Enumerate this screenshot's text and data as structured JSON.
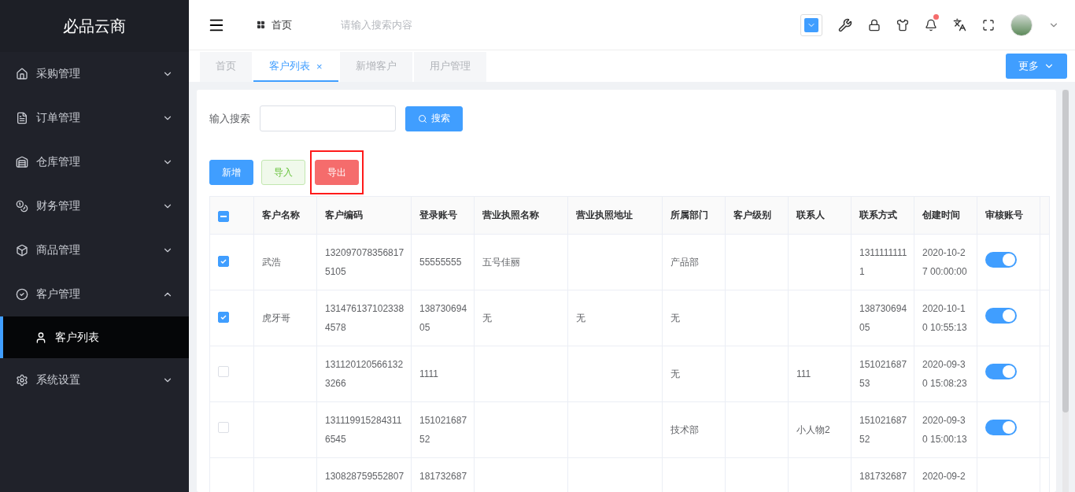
{
  "sidebar": {
    "logo": "必品云商",
    "items": [
      {
        "label": "采购管理",
        "expanded": false
      },
      {
        "label": "订单管理",
        "expanded": false
      },
      {
        "label": "仓库管理",
        "expanded": false
      },
      {
        "label": "财务管理",
        "expanded": false
      },
      {
        "label": "商品管理",
        "expanded": false
      },
      {
        "label": "客户管理",
        "expanded": true,
        "children": [
          {
            "label": "客户列表",
            "selected": true
          }
        ]
      },
      {
        "label": "系统设置",
        "expanded": false
      }
    ]
  },
  "header": {
    "breadcrumb": "首页",
    "search": {
      "placeholder": "请输入搜索内容"
    },
    "notification": true
  },
  "tabs": [
    {
      "label": "首页",
      "selected": false
    },
    {
      "label": "客户列表",
      "selected": true,
      "close": "×"
    },
    {
      "label": "新增客户",
      "selected": false
    },
    {
      "label": "用户管理",
      "selected": false
    }
  ],
  "more_button": "更多",
  "filter": {
    "label": "输入搜索",
    "search_button": "搜索"
  },
  "actions": [
    {
      "label": "新增",
      "kind": "primary",
      "highlighted": false
    },
    {
      "label": "导入",
      "kind": "success",
      "highlighted": false
    },
    {
      "label": "导出",
      "kind": "danger",
      "highlighted": true
    }
  ],
  "table": {
    "partially_selected": true,
    "columns": [
      "客户名称",
      "客户编码",
      "登录账号",
      "营业执照名称",
      "营业执照地址",
      "所属部门",
      "客户级别",
      "联系人",
      "联系方式",
      "创建时间",
      "审核账号"
    ],
    "rows": [
      {
        "selected": true,
        "cells": [
          "武浩",
          "1320970783568175105",
          "55555555",
          "五号佳丽",
          "",
          "产品部",
          "",
          "",
          "13111111111",
          "2020-10-27 00:00:00"
        ],
        "approved": true
      },
      {
        "selected": true,
        "cells": [
          "虎牙哥",
          "1314761371023384578",
          "13873069405",
          "无",
          "无",
          "无",
          "",
          "",
          "13873069405",
          "2020-10-10 10:55:13"
        ],
        "approved": true
      },
      {
        "selected": false,
        "cells": [
          "",
          "1311201205661323266",
          "1111",
          "",
          "",
          "无",
          "",
          "111",
          "15102168753",
          "2020-09-30 15:08:23"
        ],
        "approved": true
      },
      {
        "selected": false,
        "cells": [
          "",
          "1311199152843116545",
          "15102168752",
          "",
          "",
          "技术部",
          "",
          "小人物2",
          "15102168752",
          "2020-09-30 15:00:13"
        ],
        "approved": true
      },
      {
        "cells": [
          "",
          "130828759552807",
          "181732687",
          "",
          "",
          "",
          "",
          "",
          "181732687",
          "2020-09-2"
        ]
      }
    ]
  }
}
